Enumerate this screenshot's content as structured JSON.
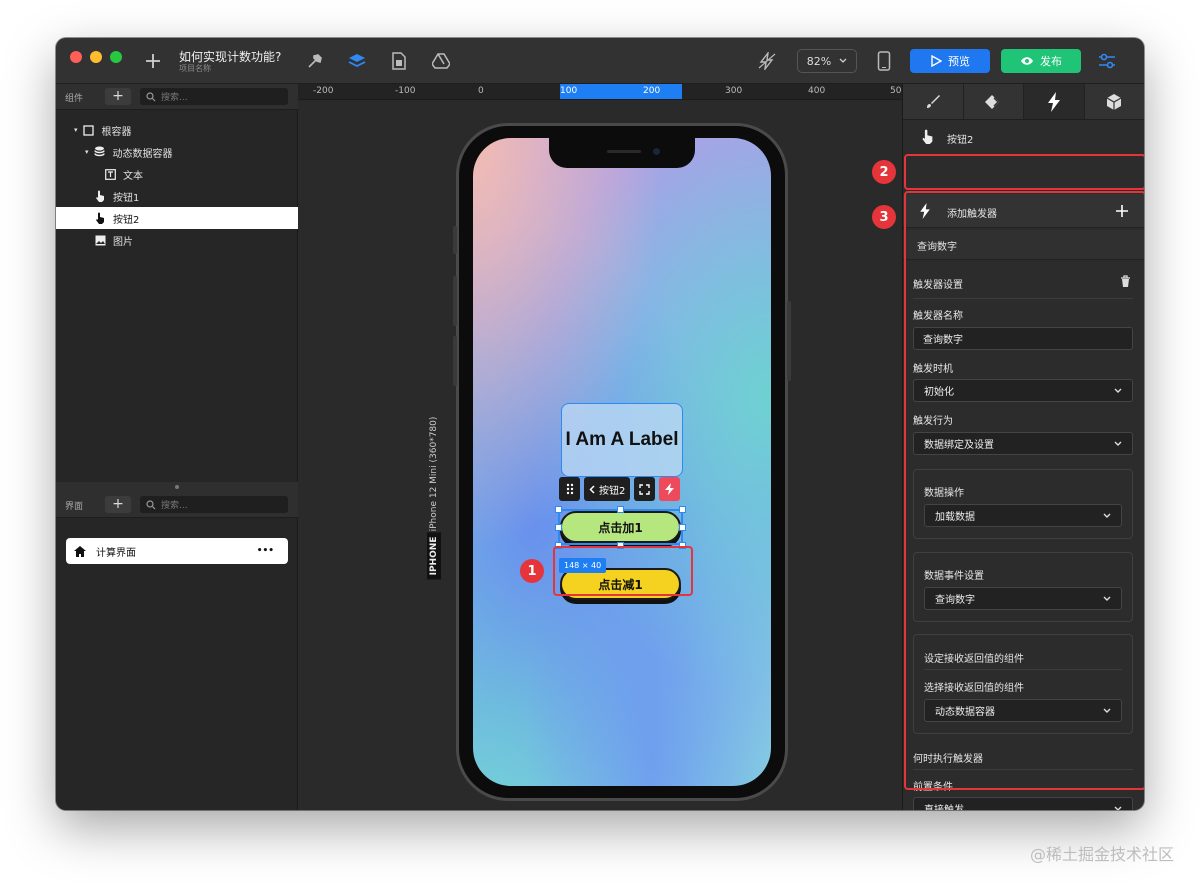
{
  "titlebar": {
    "doc_title": "如何实现计数功能?",
    "doc_subtitle": "项目名称",
    "zoom": "82%",
    "preview_label": "预览",
    "publish_label": "发布"
  },
  "layers": {
    "header_label": "组件",
    "search_placeholder": "搜索...",
    "items": [
      {
        "label": "根容器"
      },
      {
        "label": "动态数据容器"
      },
      {
        "label": "文本"
      },
      {
        "label": "按钮1"
      },
      {
        "label": "按钮2"
      },
      {
        "label": "图片"
      }
    ]
  },
  "pages": {
    "header_label": "界面",
    "search_placeholder": "搜索...",
    "items": [
      {
        "label": "计算界面",
        "more": "•••"
      }
    ]
  },
  "ruler": {
    "labels": [
      "-200",
      "-100",
      "0",
      "100",
      "200",
      "300",
      "400",
      "50"
    ]
  },
  "device": {
    "model": "iPhone 12 Mini (360*780)",
    "platform": "IPHONE"
  },
  "screen": {
    "label_text": "I Am A Label",
    "toolbar_button": "按钮2",
    "add_button": "点击加1",
    "size_badge": "148 × 40",
    "sub_button": "点击减1"
  },
  "annotations": {
    "one": "1",
    "two": "2",
    "three": "3"
  },
  "inspector": {
    "selected": "按钮2",
    "add_trigger": "添加触发器",
    "trigger_title": "查询数字",
    "settings_title": "触发器设置",
    "name_label": "触发器名称",
    "name_value": "查询数字",
    "timing_label": "触发时机",
    "timing_value": "初始化",
    "action_label": "触发行为",
    "action_value": "数据绑定及设置",
    "data_op_label": "数据操作",
    "data_op_value": "加载数据",
    "event_label": "数据事件设置",
    "event_value": "查询数字",
    "receiver_title": "设定接收返回值的组件",
    "receiver_label": "选择接收返回值的组件",
    "receiver_value": "动态数据容器",
    "when_title": "何时执行触发器",
    "precond_label": "前置条件",
    "precond_value": "直接触发"
  },
  "watermark": "@稀土掘金技术社区",
  "colors": {
    "accent_blue": "#1f78f0",
    "publish_green": "#1fc477",
    "annotation_red": "#e5353b",
    "add_button": "#b6e67e",
    "sub_button": "#f4d21f"
  }
}
